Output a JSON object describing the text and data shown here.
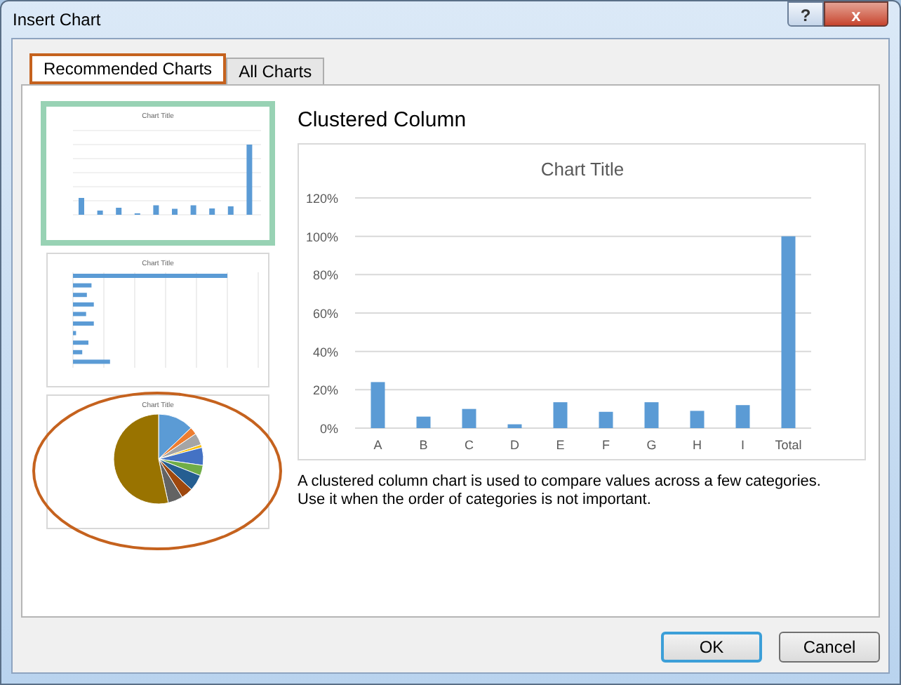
{
  "window": {
    "title": "Insert Chart",
    "buttons": [
      "?",
      "x"
    ]
  },
  "tabs": [
    {
      "label": "Recommended Charts",
      "selected": true,
      "highlighted": true
    },
    {
      "label": "All Charts",
      "selected": false,
      "highlighted": false
    }
  ],
  "thumbnails": [
    {
      "kind": "column",
      "title": "Chart Title",
      "selected": true,
      "highlighted": false
    },
    {
      "kind": "bar",
      "title": "Chart Title",
      "selected": false,
      "highlighted": false
    },
    {
      "kind": "pie",
      "title": "Chart Title",
      "selected": false,
      "highlighted": true
    }
  ],
  "preview": {
    "heading": "Clustered Column",
    "chart_data": {
      "type": "bar",
      "title": "Chart Title",
      "categories": [
        "A",
        "B",
        "C",
        "D",
        "E",
        "F",
        "G",
        "H",
        "I",
        "Total"
      ],
      "grid": true,
      "series": [
        {
          "color": "#5b9bd5",
          "values": [
            24,
            6,
            10,
            2,
            13.5,
            8.5,
            13.5,
            9,
            12,
            100
          ]
        }
      ],
      "ylim": [
        0,
        120
      ],
      "yticks": [
        {
          "value": 0,
          "label": "0%"
        },
        {
          "value": 20,
          "label": "20%"
        },
        {
          "value": 40,
          "label": "40%"
        },
        {
          "value": 60,
          "label": "60%"
        },
        {
          "value": 80,
          "label": "80%"
        },
        {
          "value": 100,
          "label": "100%"
        },
        {
          "value": 120,
          "label": "120%"
        }
      ]
    },
    "description": "A clustered column chart is used to compare values across a few categories. Use it when the order of categories is not important."
  },
  "buttons": [
    {
      "label": "OK",
      "default": true
    },
    {
      "label": "Cancel",
      "default": false
    }
  ]
}
